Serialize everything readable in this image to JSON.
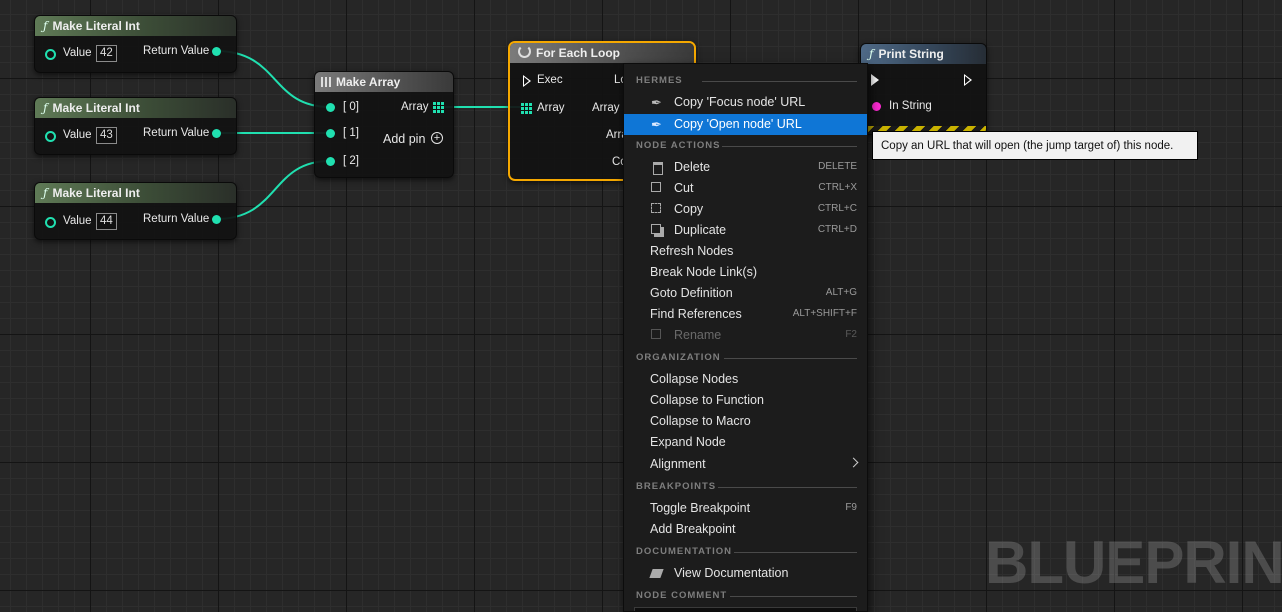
{
  "graph": {
    "literal_nodes": [
      {
        "title": "Make Literal Int",
        "value_label": "Value",
        "value": "42",
        "output_label": "Return Value"
      },
      {
        "title": "Make Literal Int",
        "value_label": "Value",
        "value": "43",
        "output_label": "Return Value"
      },
      {
        "title": "Make Literal Int",
        "value_label": "Value",
        "value": "44",
        "output_label": "Return Value"
      }
    ],
    "make_array": {
      "title": "Make Array",
      "inputs": [
        "[ 0]",
        "[ 1]",
        "[ 2]"
      ],
      "output_label": "Array",
      "add_pin_label": "Add pin"
    },
    "for_each": {
      "title": "For Each Loop",
      "exec_label": "Exec",
      "array_label": "Array",
      "out_loop_partial": "Lo",
      "out_array_partial": "Array I",
      "out_arra_partial": "Arra",
      "out_co_partial": "Co"
    },
    "print_string": {
      "title": "Print String",
      "in_string_label": "In String"
    },
    "function_glyph": "ƒ",
    "watermark": "BLUEPRINT"
  },
  "context_menu": {
    "sections": [
      {
        "title": "HERMES",
        "items": [
          {
            "label": "Copy 'Focus node' URL",
            "shortcut": "",
            "icon": "hermes-feather-icon"
          },
          {
            "label": "Copy 'Open node' URL",
            "shortcut": "",
            "icon": "hermes-feather-icon",
            "highlighted": true
          }
        ]
      },
      {
        "title": "NODE ACTIONS",
        "items": [
          {
            "label": "Delete",
            "shortcut": "DELETE",
            "icon": "trash-icon"
          },
          {
            "label": "Cut",
            "shortcut": "CTRL+X",
            "icon": "cut-icon"
          },
          {
            "label": "Copy",
            "shortcut": "CTRL+C",
            "icon": "copy-icon"
          },
          {
            "label": "Duplicate",
            "shortcut": "CTRL+D",
            "icon": "duplicate-icon"
          },
          {
            "label": "Refresh Nodes",
            "shortcut": ""
          },
          {
            "label": "Break Node Link(s)",
            "shortcut": ""
          },
          {
            "label": "Goto Definition",
            "shortcut": "ALT+G"
          },
          {
            "label": "Find References",
            "shortcut": "ALT+SHIFT+F"
          },
          {
            "label": "Rename",
            "shortcut": "F2",
            "icon": "rename-icon",
            "disabled": true
          }
        ]
      },
      {
        "title": "ORGANIZATION",
        "items": [
          {
            "label": "Collapse Nodes",
            "shortcut": ""
          },
          {
            "label": "Collapse to Function",
            "shortcut": ""
          },
          {
            "label": "Collapse to Macro",
            "shortcut": ""
          },
          {
            "label": "Expand Node",
            "shortcut": ""
          },
          {
            "label": "Alignment",
            "shortcut": "",
            "submenu": true
          }
        ]
      },
      {
        "title": "BREAKPOINTS",
        "items": [
          {
            "label": "Toggle Breakpoint",
            "shortcut": "F9"
          },
          {
            "label": "Add Breakpoint",
            "shortcut": ""
          }
        ]
      },
      {
        "title": "DOCUMENTATION",
        "items": [
          {
            "label": "View Documentation",
            "shortcut": "",
            "icon": "documentation-icon"
          }
        ]
      },
      {
        "title": "NODE COMMENT",
        "items": []
      }
    ]
  },
  "tooltip": {
    "text": "Copy an URL that will open (the jump target of) this node."
  }
}
